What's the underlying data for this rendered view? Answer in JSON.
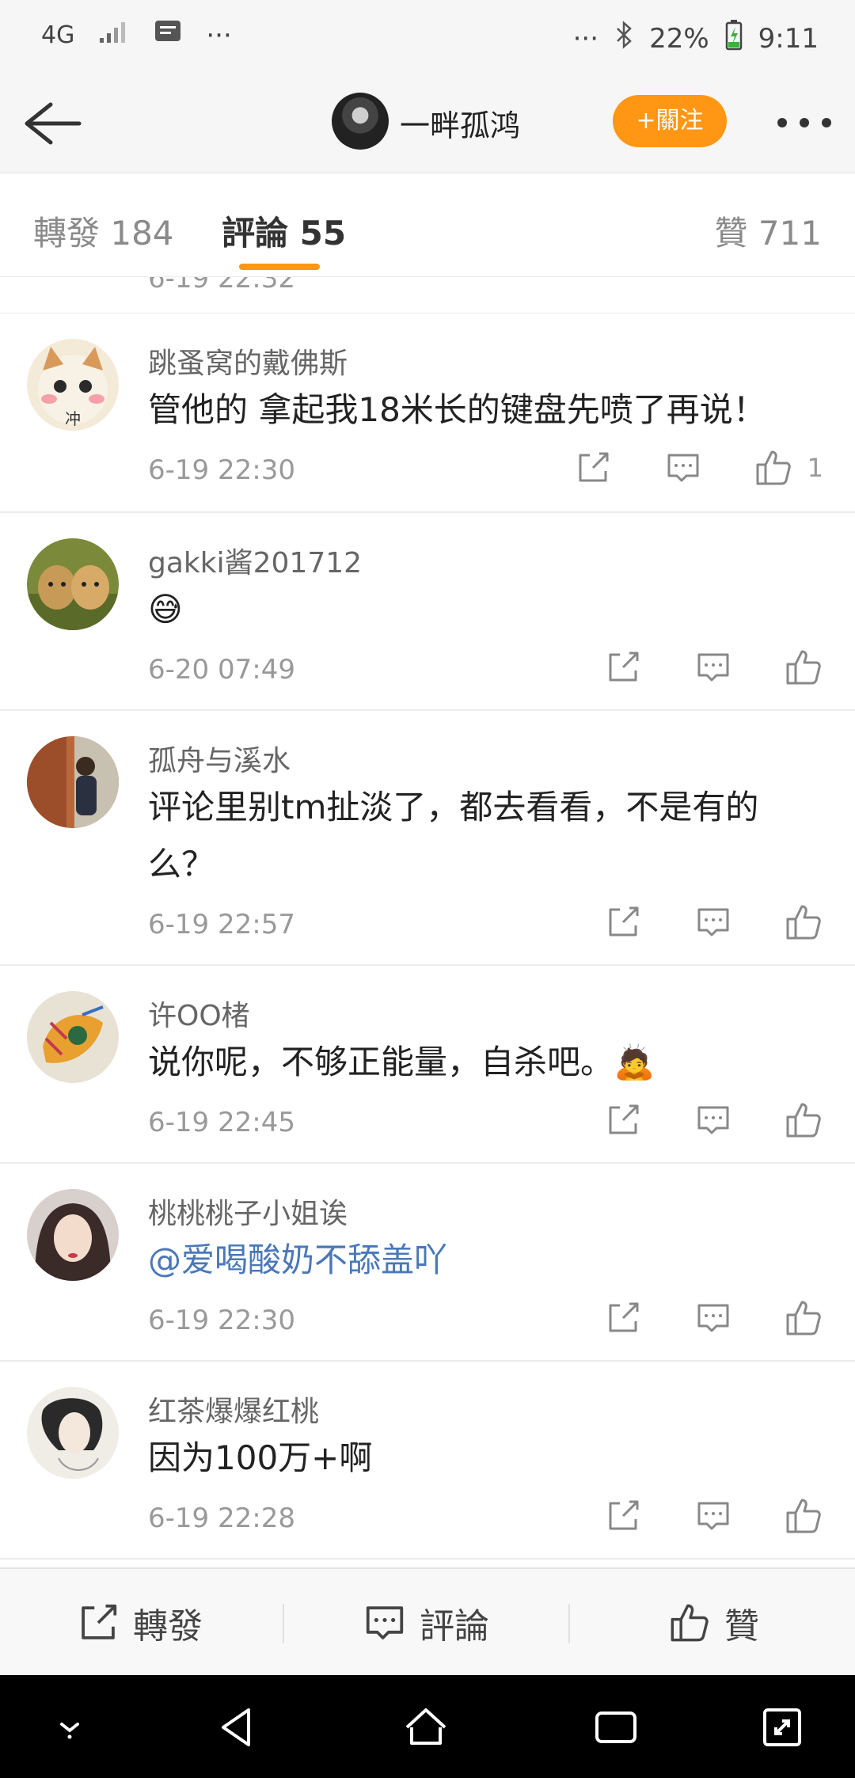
{
  "status": {
    "network": "4G",
    "overflow": "···",
    "battery": "22%",
    "time": "9:11"
  },
  "header": {
    "title": "一畔孤鸿",
    "follow_label": "+關注"
  },
  "tabs": [
    {
      "label": "轉發 184"
    },
    {
      "label": "評論 55"
    },
    {
      "label": "贊 711"
    }
  ],
  "clipped_time": "6-19 22:32",
  "comments": [
    {
      "name": "跳蚤窝的戴佛斯",
      "text": "管他的 拿起我18米长的键盘先喷了再说！",
      "time": "6-19 22:30",
      "likes": "1"
    },
    {
      "name": "gakki酱201712",
      "text": "😅",
      "time": "6-20 07:49",
      "likes": ""
    },
    {
      "name": "孤舟与溪水",
      "text": "评论里别tm扯淡了，都去看看，不是有的么？",
      "time": "6-19 22:57",
      "likes": ""
    },
    {
      "name": "许OO楮",
      "text": "说你呢，不够正能量，自杀吧。🙇",
      "time": "6-19 22:45",
      "likes": ""
    },
    {
      "name": "桃桃桃子小姐诶",
      "text": "@爱喝酸奶不舔盖吖",
      "time": "6-19 22:30",
      "likes": ""
    },
    {
      "name": "红茶爆爆红桃",
      "text": "因为100万+啊",
      "time": "6-19 22:28",
      "likes": ""
    }
  ],
  "bottom": {
    "repost": "轉發",
    "comment": "評論",
    "like": "贊"
  },
  "colors": {
    "accent": "#ff9614",
    "mention": "#4a78b8"
  }
}
